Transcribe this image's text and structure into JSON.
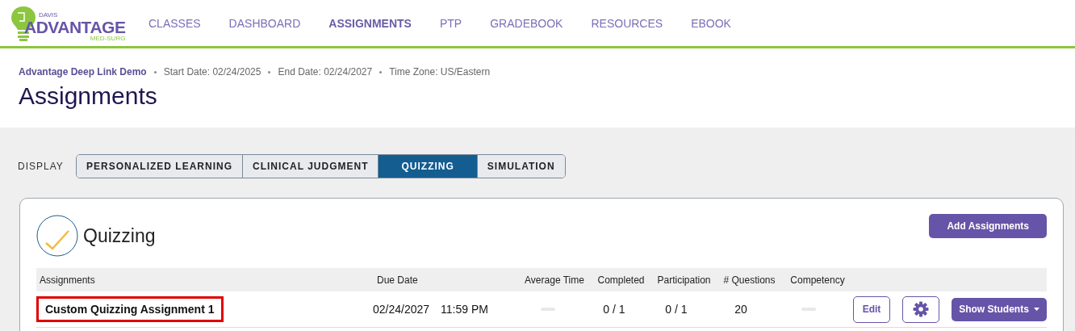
{
  "logo": {
    "top": "DAVIS",
    "main": "ADVANTAGE",
    "sub": "MED-SURG"
  },
  "nav": [
    {
      "label": "CLASSES",
      "selected": false
    },
    {
      "label": "DASHBOARD",
      "selected": false
    },
    {
      "label": "ASSIGNMENTS",
      "selected": true
    },
    {
      "label": "PTP",
      "selected": false
    },
    {
      "label": "GRADEBOOK",
      "selected": false
    },
    {
      "label": "RESOURCES",
      "selected": false
    },
    {
      "label": "EBOOK",
      "selected": false
    }
  ],
  "course": {
    "name": "Advantage Deep Link Demo",
    "details": [
      "Start Date: 02/24/2025",
      "End Date: 02/24/2027",
      "Time Zone: US/Eastern"
    ]
  },
  "page_title": "Assignments",
  "display": {
    "label": "DISPLAY",
    "tabs": [
      {
        "label": "PERSONALIZED LEARNING",
        "selected": false
      },
      {
        "label": "CLINICAL JUDGMENT",
        "selected": false
      },
      {
        "label": "QUIZZING",
        "selected": true
      },
      {
        "label": "SIMULATION",
        "selected": false
      }
    ]
  },
  "card": {
    "title": "Quizzing",
    "add_button": "Add Assignments",
    "table": {
      "columns": [
        "Assignments",
        "Due Date",
        "Average Time",
        "Completed",
        "Participation",
        "# Questions",
        "Competency"
      ],
      "rows": [
        {
          "name": "Custom Quizzing Assignment 1",
          "highlighted": true,
          "due_date": "02/24/2027",
          "due_time": "11:59 PM",
          "completed": "0 / 1",
          "participation": "0 / 1",
          "questions": "20",
          "edit": "Edit",
          "show": "Show Students"
        }
      ]
    }
  }
}
